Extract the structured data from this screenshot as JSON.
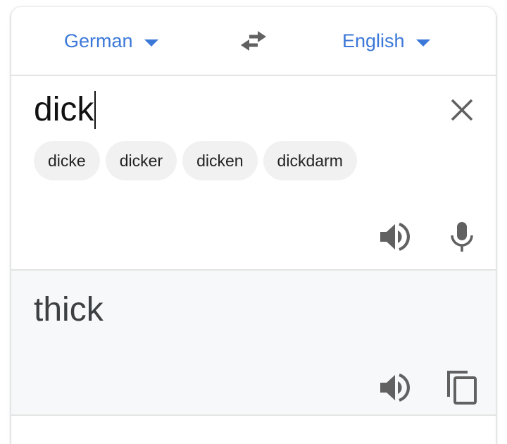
{
  "languages": {
    "source": "German",
    "target": "English"
  },
  "input": {
    "text": "dick"
  },
  "suggestions": [
    {
      "label": "dicke"
    },
    {
      "label": "dicker"
    },
    {
      "label": "dicken"
    },
    {
      "label": "dickdarm"
    }
  ],
  "output": {
    "text": "thick"
  },
  "icons": {
    "swap": "swap-arrows-icon",
    "clear": "close-icon",
    "speaker": "speaker-icon",
    "mic": "microphone-icon",
    "copy": "copy-icon"
  },
  "colors": {
    "accent": "#3c78d8",
    "icon": "#616161",
    "output_bg": "#f7f8fa",
    "chip_bg": "#f1f1f1"
  }
}
